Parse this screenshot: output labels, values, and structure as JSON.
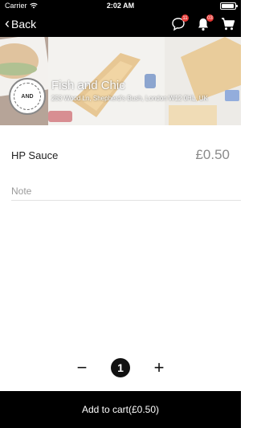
{
  "status_bar": {
    "carrier": "Carrier",
    "time": "2:02 AM"
  },
  "nav": {
    "back_label": "Back",
    "chat_badge": "11",
    "notification_badge": "03"
  },
  "restaurant": {
    "name": "Fish and Chic",
    "address": "253 Wood Ln, Shepherd's Bush, London W12 0HL, UK",
    "logo_text": "AND"
  },
  "item": {
    "name": "HP Sauce",
    "price": "£0.50"
  },
  "note": {
    "placeholder": "Note",
    "value": ""
  },
  "quantity": {
    "value": "1",
    "decrement": "−",
    "increment": "+"
  },
  "cart_button": {
    "label": "Add to cart(£0.50)"
  },
  "colors": {
    "bar": "#000000",
    "badge": "#e53935",
    "price": "#8a8a8a"
  }
}
